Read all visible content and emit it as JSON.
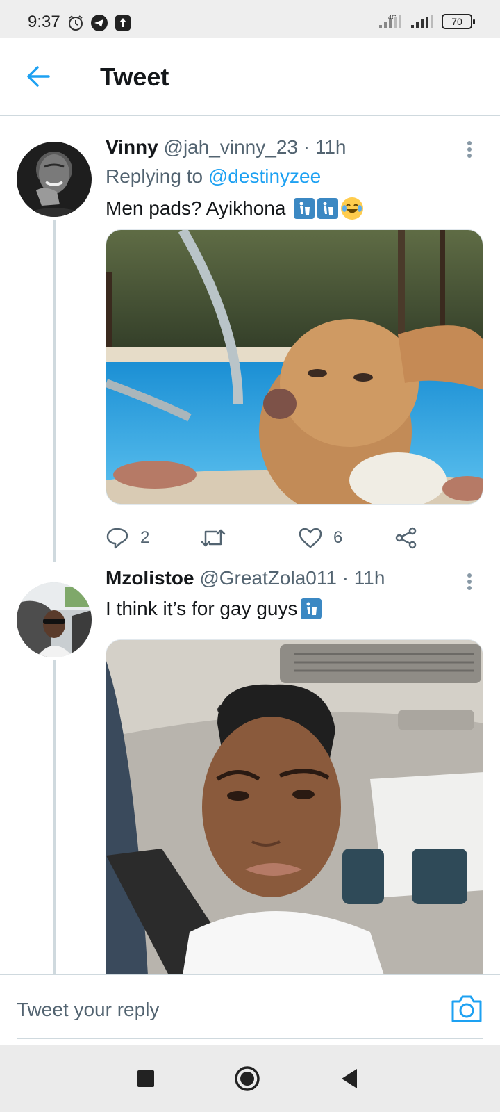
{
  "status_bar": {
    "time": "9:37",
    "network": "4G",
    "battery": "70",
    "icons": [
      "alarm-icon",
      "telegram-icon",
      "upload-icon",
      "signal-icon",
      "signal-icon",
      "battery-icon"
    ]
  },
  "header": {
    "title": "Tweet",
    "back_icon": "back-arrow-icon"
  },
  "tweets": [
    {
      "name": "Vinny",
      "handle": "@jah_vinny_23",
      "time": "· 11h",
      "replying_prefix": "Replying to",
      "replying_to": "@destinyzee",
      "text": "Men pads? Ayikhona",
      "emoji": [
        "put-litter-icon",
        "put-litter-icon",
        "tears-of-joy-icon"
      ],
      "media": "chihuahua-in-pool-photo",
      "actions": {
        "reply_count": "2",
        "retweet_count": "",
        "like_count": "6"
      }
    },
    {
      "name": "Mzolistoe",
      "handle": "@GreatZola011",
      "time": "· 11h",
      "text": "I think it’s for gay guys",
      "emoji": [
        "put-litter-icon"
      ],
      "media": "woman-in-car-selfie-photo"
    }
  ],
  "composer": {
    "placeholder": "Tweet your reply",
    "camera_icon": "camera-icon"
  },
  "navbar": {
    "buttons": [
      "recents-square-icon",
      "home-circle-icon",
      "back-triangle-icon"
    ]
  },
  "colors": {
    "accent": "#1da1f2",
    "text_primary": "#14171a",
    "text_secondary": "#536471",
    "thread_line": "#cfd9de"
  }
}
